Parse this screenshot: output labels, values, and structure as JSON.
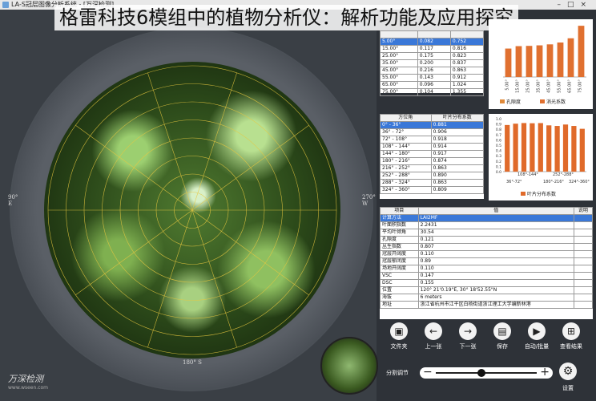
{
  "window": {
    "title": "LA-S冠层图像分析系统 - [万深检测]"
  },
  "overlay_title": "格雷科技6模组中的植物分析仪：解析功能及应用探究",
  "image_view": {
    "labels": {
      "left": "90°\nE",
      "right": "270°\nW",
      "bottom": "180° S"
    },
    "logo": {
      "brand": "万深检测",
      "sub": "www.wseen.com"
    }
  },
  "zenith_table": {
    "headers": [
      "",
      "",
      ""
    ],
    "rows": [
      [
        "5.00°",
        "0.082",
        "0.752"
      ],
      [
        "15.00°",
        "0.117",
        "0.816"
      ],
      [
        "25.00°",
        "0.175",
        "0.823"
      ],
      [
        "35.00°",
        "0.200",
        "0.837"
      ],
      [
        "45.00°",
        "0.216",
        "0.863"
      ],
      [
        "55.00°",
        "0.143",
        "0.912"
      ],
      [
        "65.00°",
        "0.096",
        "1.024"
      ],
      [
        "75.00°",
        "0.104",
        "1.355"
      ]
    ],
    "selected": 0
  },
  "azimuth_table": {
    "headers": [
      "方位角",
      "叶片分布系数"
    ],
    "rows": [
      [
        "0° - 36°",
        "0.881"
      ],
      [
        "36° - 72°",
        "0.906"
      ],
      [
        "72° - 108°",
        "0.918"
      ],
      [
        "108° - 144°",
        "0.914"
      ],
      [
        "144° - 180°",
        "0.917"
      ],
      [
        "180° - 216°",
        "0.874"
      ],
      [
        "216° - 252°",
        "0.863"
      ],
      [
        "252° - 288°",
        "0.890"
      ],
      [
        "288° - 324°",
        "0.863"
      ],
      [
        "324° - 360°",
        "0.809"
      ]
    ],
    "selected": 0
  },
  "results_table": {
    "headers": [
      "项目",
      "值",
      "说明"
    ],
    "rows": [
      [
        "计算方法",
        "LAI2MF",
        ""
      ],
      [
        "叶面积指数",
        "2.2431",
        ""
      ],
      [
        "平均叶倾角",
        "30.54",
        ""
      ],
      [
        "孔隙度",
        "0.121",
        ""
      ],
      [
        "丛生指数",
        "0.807",
        ""
      ],
      [
        "冠层开阔度",
        "0.110",
        ""
      ],
      [
        "冠层郁闭度",
        "0.89",
        ""
      ],
      [
        "场地开阔度",
        "0.110",
        ""
      ],
      [
        "VSC",
        "0.147",
        ""
      ],
      [
        "DSC",
        "0.155",
        ""
      ],
      [
        "位置",
        "120° 21'0.19\"E, 30° 18'52.55\"N",
        ""
      ],
      [
        "海拔",
        "6 meters",
        ""
      ],
      [
        "地址",
        "浙江省杭州市江干区白杨街道浙江理工大学编新林港",
        ""
      ]
    ],
    "selected": 0
  },
  "toolbar": {
    "open": "文件夹",
    "prev": "上一张",
    "next": "下一张",
    "save": "保存",
    "auto": "自动/批量",
    "results": "查看结果"
  },
  "slider": {
    "label": "分割调节",
    "value_fraction": 0.45
  },
  "settings_label": "设置",
  "chart_data": [
    {
      "type": "bar",
      "categories": [
        "5.00°",
        "15.00°",
        "25.00°",
        "35.00°",
        "45.00°",
        "55.00°",
        "65.00°",
        "75.00°"
      ],
      "series": [
        {
          "name": "孔隙度",
          "values": [
            0.082,
            0.117,
            0.175,
            0.2,
            0.216,
            0.143,
            0.096,
            0.104
          ],
          "color": "#e08a3a"
        },
        {
          "name": "消光系数",
          "values": [
            0.752,
            0.816,
            0.823,
            0.837,
            0.863,
            0.912,
            1.024,
            1.355
          ],
          "color": "#e07030"
        }
      ],
      "ylim": [
        0,
        1.4
      ],
      "legend": "bottom"
    },
    {
      "type": "bar",
      "categories": [
        "0°-36°",
        "36°-72°",
        "72°-108°",
        "108°-144°",
        "144°-180°",
        "180°-216°",
        "216°-252°",
        "252°-288°",
        "288°-324°",
        "324°-360°"
      ],
      "tick_labels": [
        "108°-144°",
        "252°-288°",
        "36°-72°",
        "180°-216°",
        "324°-360°"
      ],
      "series": [
        {
          "name": "叶片分布系数",
          "values": [
            0.881,
            0.906,
            0.918,
            0.914,
            0.917,
            0.874,
            0.863,
            0.89,
            0.863,
            0.809
          ]
        }
      ],
      "ylim": [
        0,
        1.0
      ],
      "yticks": [
        "0.0",
        "0.1",
        "0.2",
        "0.3",
        "0.4",
        "0.5",
        "0.6",
        "0.7",
        "0.8",
        "0.9",
        "1.0"
      ],
      "legend": "bottom",
      "color": "#e06a2a"
    }
  ]
}
